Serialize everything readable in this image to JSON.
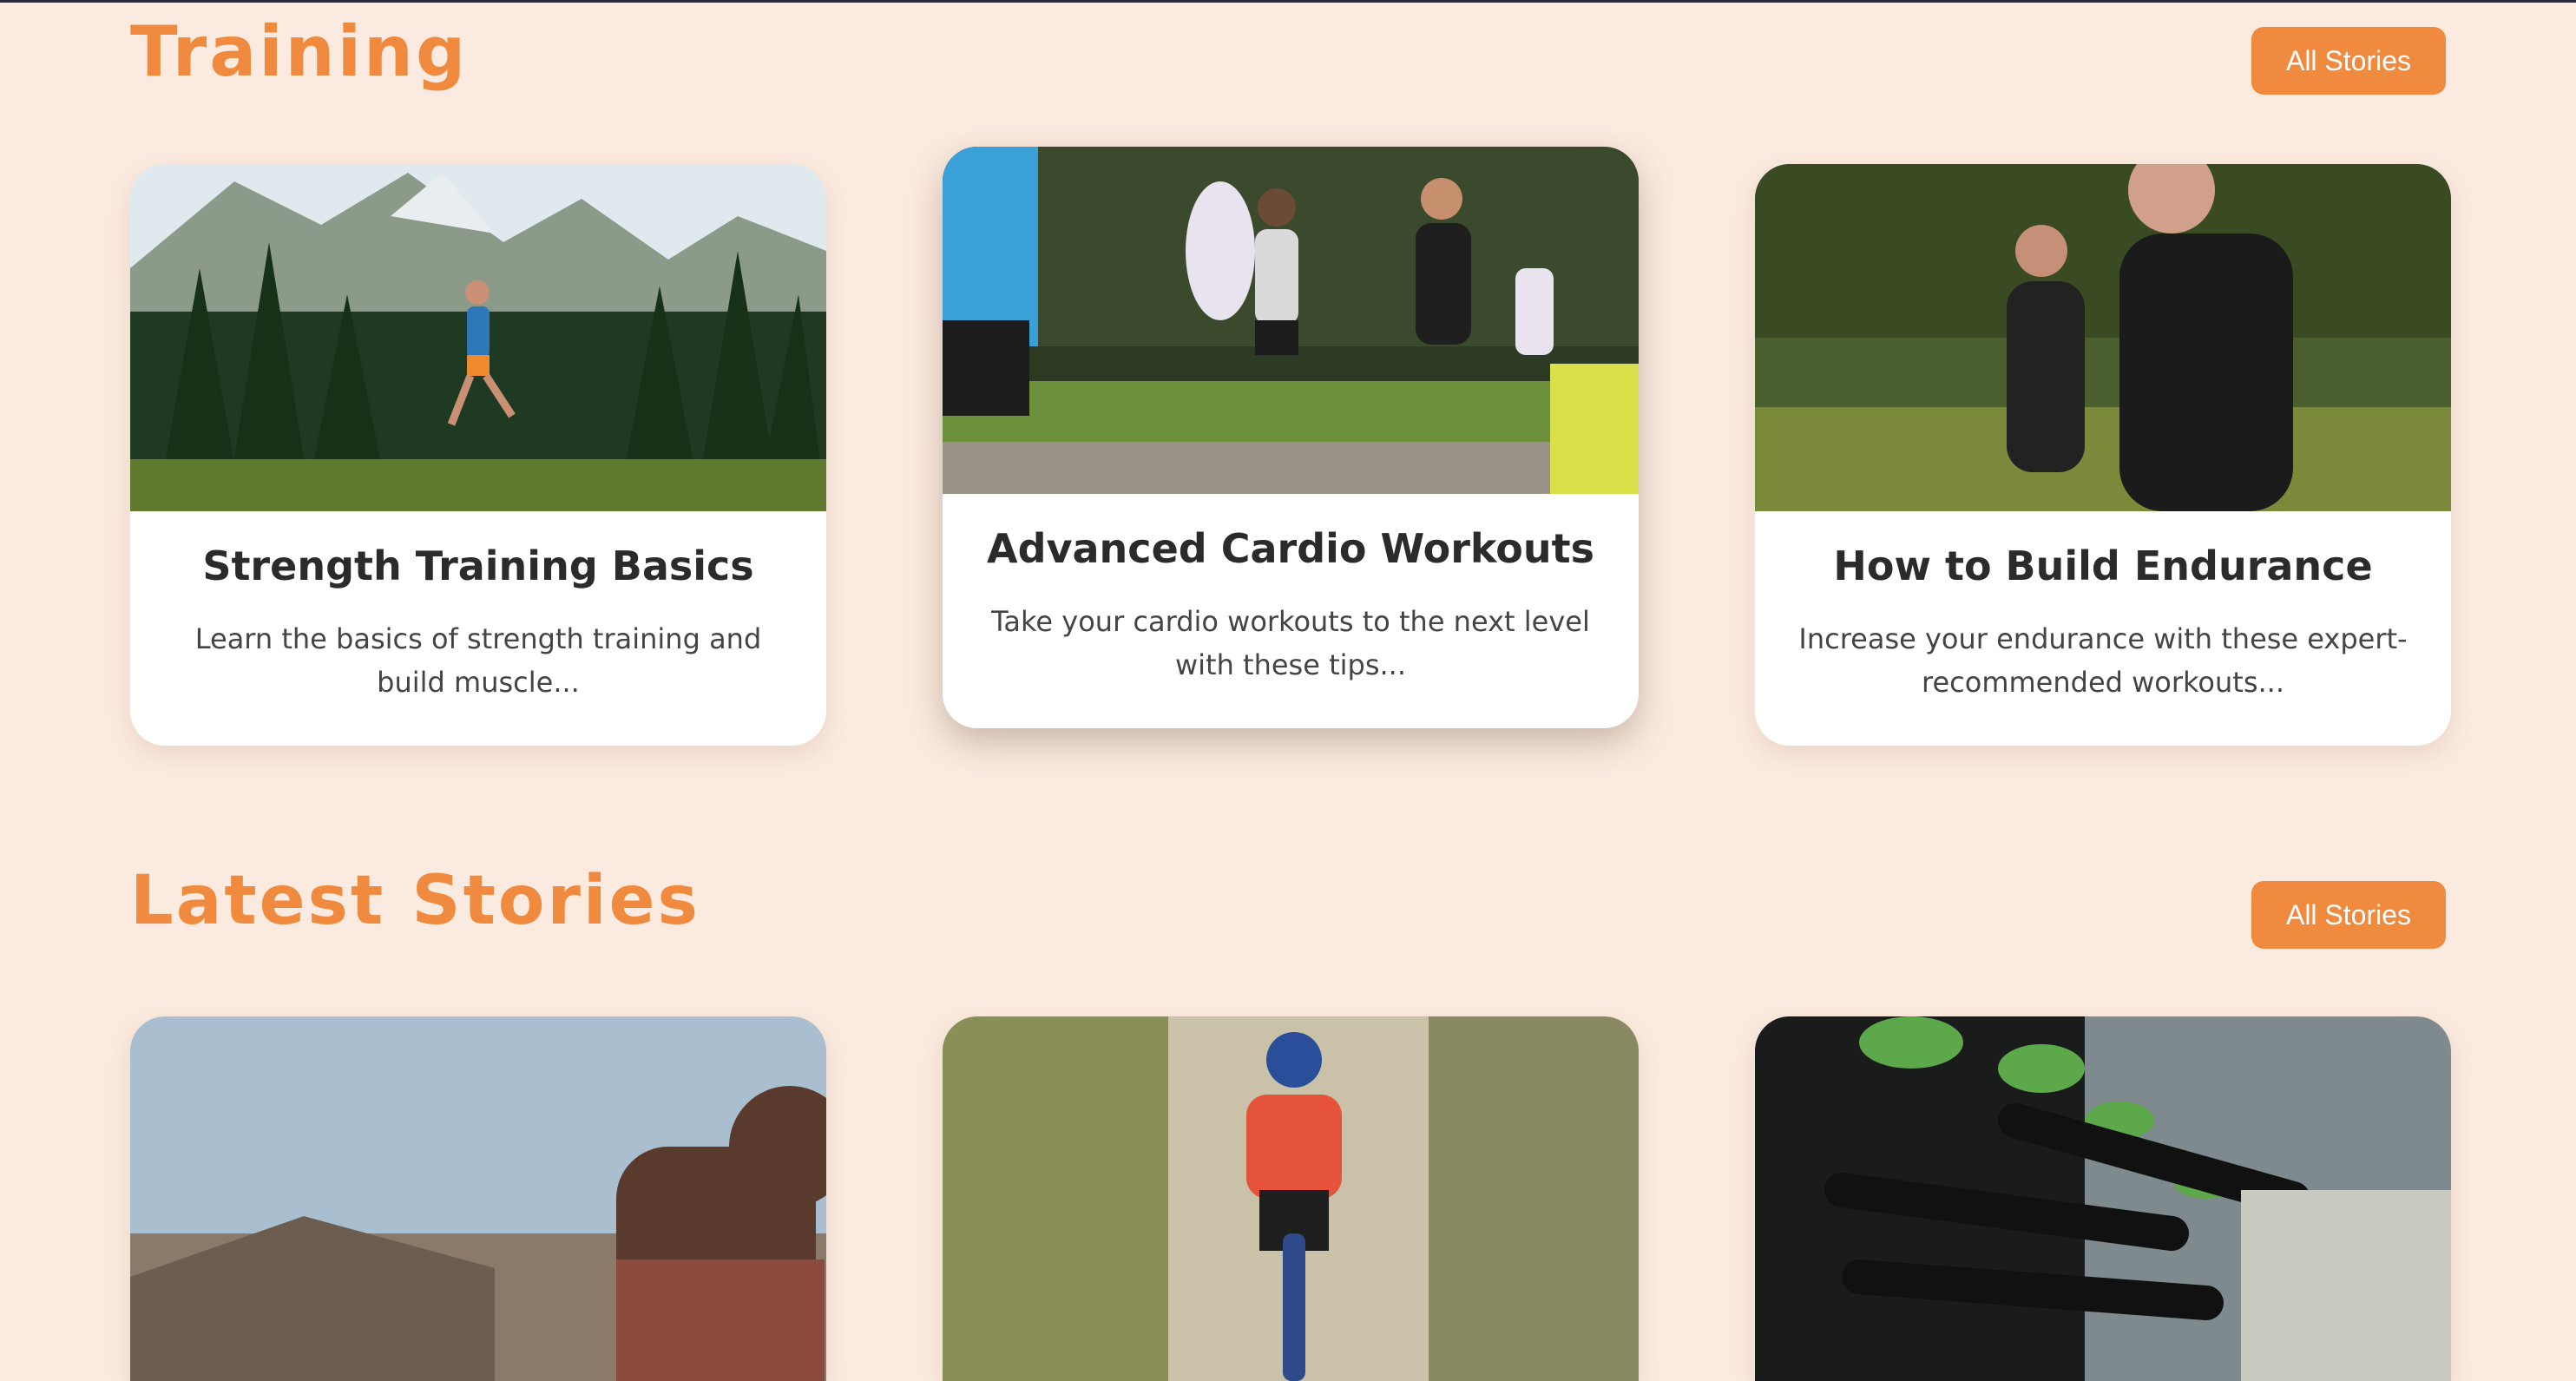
{
  "sections": {
    "training": {
      "title": "Training",
      "all_label": "All Stories",
      "cards": [
        {
          "title": "Strength Training Basics",
          "desc": "Learn the basics of strength training and build muscle..."
        },
        {
          "title": "Advanced Cardio Workouts",
          "desc": "Take your cardio workouts to the next level with these tips..."
        },
        {
          "title": "How to Build Endurance",
          "desc": "Increase your endurance with these expert-recommended workouts..."
        }
      ]
    },
    "latest": {
      "title": "Latest Stories",
      "all_label": "All Stories"
    }
  },
  "theme": {
    "accent": "#ef8a3f",
    "background": "#fbeadf",
    "card": "#ffffff"
  },
  "images": {
    "training": [
      "trail-runner-mountains-photo",
      "parkrun-group-runners-photo",
      "endurance-runners-photo"
    ],
    "latest": [
      "athlete-stretching-photo",
      "gravel-cyclist-photo",
      "triathlon-swim-start-photo"
    ]
  }
}
